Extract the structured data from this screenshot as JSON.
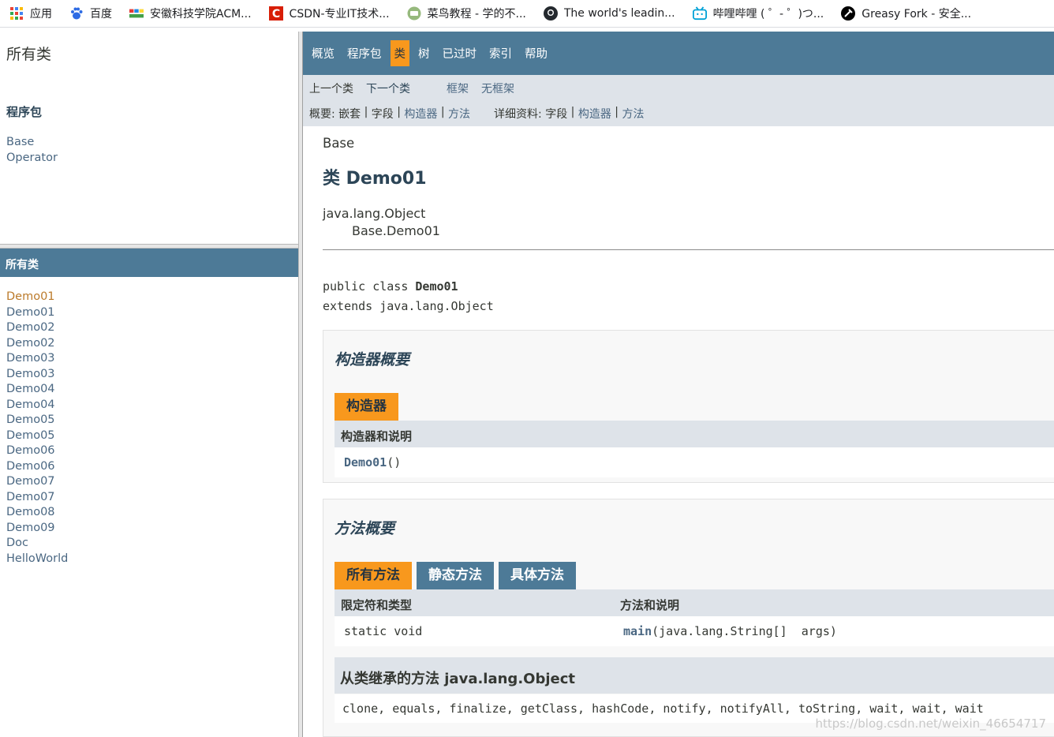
{
  "bookmarks": [
    {
      "icon": "apps-grid-icon",
      "label": "应用"
    },
    {
      "icon": "baidu-paw-icon",
      "label": "百度"
    },
    {
      "icon": "acm-logo-icon",
      "label": "安徽科技学院ACM..."
    },
    {
      "icon": "csdn-logo-icon",
      "label": "CSDN-专业IT技术..."
    },
    {
      "icon": "runoob-logo-icon",
      "label": "菜鸟教程 - 学的不..."
    },
    {
      "icon": "github-logo-icon",
      "label": "The world's leadin..."
    },
    {
      "icon": "bilibili-logo-icon",
      "label": "哔哩哔哩 ( ゜- ゜)つ..."
    },
    {
      "icon": "greasyfork-logo-icon",
      "label": "Greasy Fork - 安全..."
    }
  ],
  "package_frame": {
    "title": "所有类",
    "subtitle": "程序包",
    "packages": [
      "Base",
      "Operator"
    ]
  },
  "class_frame": {
    "header": "所有类",
    "classes": [
      "Demo01",
      "Demo01",
      "Demo02",
      "Demo02",
      "Demo03",
      "Demo03",
      "Demo04",
      "Demo04",
      "Demo05",
      "Demo05",
      "Demo06",
      "Demo06",
      "Demo07",
      "Demo07",
      "Demo08",
      "Demo09",
      "Doc",
      "HelloWorld"
    ],
    "active_index": 0
  },
  "topnav": {
    "items": [
      "概览",
      "程序包",
      "类",
      "树",
      "已过时",
      "索引",
      "帮助"
    ],
    "current_index": 2
  },
  "subnav": {
    "prev_class": "上一个类",
    "next_class": "下一个类",
    "frames": "框架",
    "no_frames": "无框架",
    "summary_label": "概要: ",
    "summary_nested": "嵌套",
    "summary_field": "字段",
    "summary_ctor": "构造器",
    "summary_method": "方法",
    "detail_label": "详细资料: ",
    "detail_field": "字段",
    "detail_ctor": "构造器",
    "detail_method": "方法",
    "sep": " | "
  },
  "class_header": {
    "package": "Base",
    "title": "类 Demo01",
    "inheritance": [
      "java.lang.Object",
      "Base.Demo01"
    ]
  },
  "declaration": {
    "line1_prefix": "public class ",
    "line1_name": "Demo01",
    "line2": "extends java.lang.Object"
  },
  "constructor_summary": {
    "heading": "构造器概要",
    "tab": "构造器",
    "column": "构造器和说明",
    "rows": [
      {
        "name": "Demo01",
        "params": "()"
      }
    ]
  },
  "method_summary": {
    "heading": "方法概要",
    "tabs": [
      "所有方法",
      "静态方法",
      "具体方法"
    ],
    "active_tab": 0,
    "columns": [
      "限定符和类型",
      "方法和说明"
    ],
    "rows": [
      {
        "modifier": "static void",
        "name": "main",
        "params": "(java.lang.String[]  args)"
      }
    ],
    "inherited_heading": "从类继承的方法 java.lang.Object",
    "inherited_methods": "clone, equals, finalize, getClass, hashCode, notify, notifyAll, toString, wait, wait, wait"
  },
  "watermark": "https://blog.csdn.net/weixin_46654717",
  "colors": {
    "nav_bg": "#4d7a97",
    "nav_current": "#f8981d",
    "subnav_bg": "#dee3e9",
    "link": "#4a6782",
    "active_class": "#bb7a2a"
  }
}
